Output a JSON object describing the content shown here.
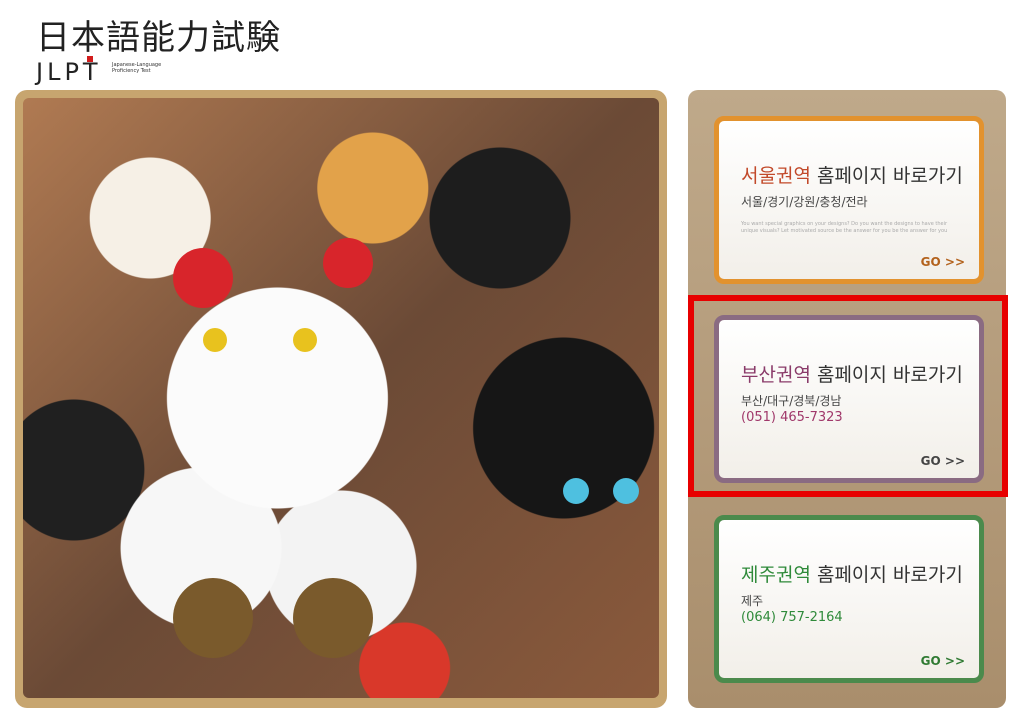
{
  "header": {
    "logo_japanese": "日本語能力試験",
    "logo_abbr": "JLPT",
    "logo_sub": "Japanese-Language Proficiency Test"
  },
  "photo": {
    "subject": "maneki-neko-figurines"
  },
  "cards": [
    {
      "region": "서울권역",
      "rest": " 홈페이지 바로가기",
      "cities": "서울/경기/강원/충청/전라",
      "phone": "",
      "fine": "You want special graphics on your designs? Do you want the designs to have their unique visuals? Let motivated source be the answer for you be the answer for you",
      "go": "GO >>",
      "accent": "#e2922e"
    },
    {
      "region": "부산권역",
      "rest": " 홈페이지 바로가기",
      "cities": "부산/대구/경북/경남",
      "phone": "(051) 465-7323",
      "fine": "",
      "go": "GO >>",
      "accent": "#8a6b82"
    },
    {
      "region": "제주권역",
      "rest": " 홈페이지 바로가기",
      "cities": "제주",
      "phone": "(064) 757-2164",
      "fine": "",
      "go": "GO >>",
      "accent": "#4b8a4c"
    }
  ],
  "colors": {
    "highlight": "#e70000",
    "panel": "#b39a78"
  }
}
